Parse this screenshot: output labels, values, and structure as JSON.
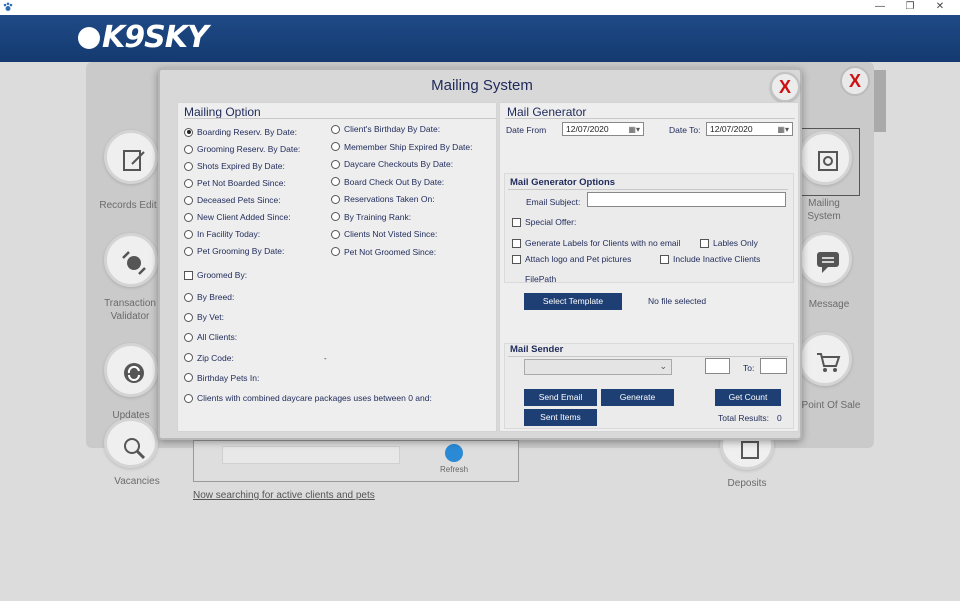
{
  "window": {
    "min": "—",
    "restore": "❐",
    "close": "✕"
  },
  "app": {
    "logo_text": "K9SKY"
  },
  "dashboard": {
    "labels": {
      "records_edit": "Records Edit",
      "transaction_validator": "Transaction\nValidator",
      "updates": "Updates",
      "vacancies": "Vacancies",
      "mailing_system": "Mailing\nSystem",
      "message": "Message",
      "point_of_sale": "Point Of Sale",
      "deposits": "Deposits"
    },
    "refresh_label": "Refresh",
    "searching_text": "Now searching for active clients and pets",
    "close_label": "X"
  },
  "dialog": {
    "title": "Mailing System",
    "close_label": "X",
    "mailing_option": {
      "title": "Mailing Option",
      "col1": [
        {
          "label": "Boarding Reserv. By Date:",
          "selected": true
        },
        {
          "label": "Grooming Reserv. By Date:",
          "selected": false
        },
        {
          "label": "Shots Expired By Date:",
          "selected": false
        },
        {
          "label": "Pet Not Boarded Since:",
          "selected": false
        },
        {
          "label": "Deceased Pets  Since:",
          "selected": false
        },
        {
          "label": "New Client Added Since:",
          "selected": false
        },
        {
          "label": "In Facility Today:",
          "selected": false
        },
        {
          "label": "Pet Grooming By Date:",
          "selected": false
        }
      ],
      "col2": [
        {
          "label": "Client's Birthday By Date:",
          "selected": false
        },
        {
          "label": "Memember Ship Expired By Date:",
          "selected": false
        },
        {
          "label": "Daycare Checkouts By Date:",
          "selected": false
        },
        {
          "label": "Board Check Out By Date:",
          "selected": false
        },
        {
          "label": "Reservations Taken On:",
          "selected": false
        },
        {
          "label": "By Training Rank:",
          "selected": false
        },
        {
          "label": "Clients Not Visted Since:",
          "selected": false
        },
        {
          "label": "Pet Not Groomed Since:",
          "selected": false
        }
      ],
      "groomed_by": "Groomed By:",
      "lower": [
        {
          "label": "By Breed:"
        },
        {
          "label": "By Vet:"
        },
        {
          "label": "All Clients:"
        },
        {
          "label": "Zip Code:"
        },
        {
          "label": "Birthday Pets In:"
        },
        {
          "label": "Clients with combined daycare packages uses between 0 and:"
        }
      ],
      "zip_dash": "-"
    },
    "generator": {
      "title": "Mail Generator",
      "date_from_label": "Date From",
      "date_from": "12/07/2020",
      "date_to_label": "Date To:",
      "date_to": "12/07/2020",
      "options_title": "Mail Generator Options",
      "email_subject_label": "Email Subject:",
      "email_subject": "",
      "special_offer": "Special Offer:",
      "gen_labels": "Generate Labels for Clients with no email",
      "labels_only": "Lables Only",
      "attach_logo": "Attach logo and Pet pictures",
      "include_inactive": "Include Inactive Clients",
      "filepath_label": "FilePath",
      "select_template": "Select Template",
      "no_file": "No file selected"
    },
    "sender": {
      "title": "Mail Sender",
      "to_label": "To:",
      "send_email": "Send Email",
      "generate": "Generate",
      "get_count": "Get Count",
      "sent_items": "Sent Items",
      "total_results_label": "Total Results:",
      "total_results": "0"
    }
  }
}
